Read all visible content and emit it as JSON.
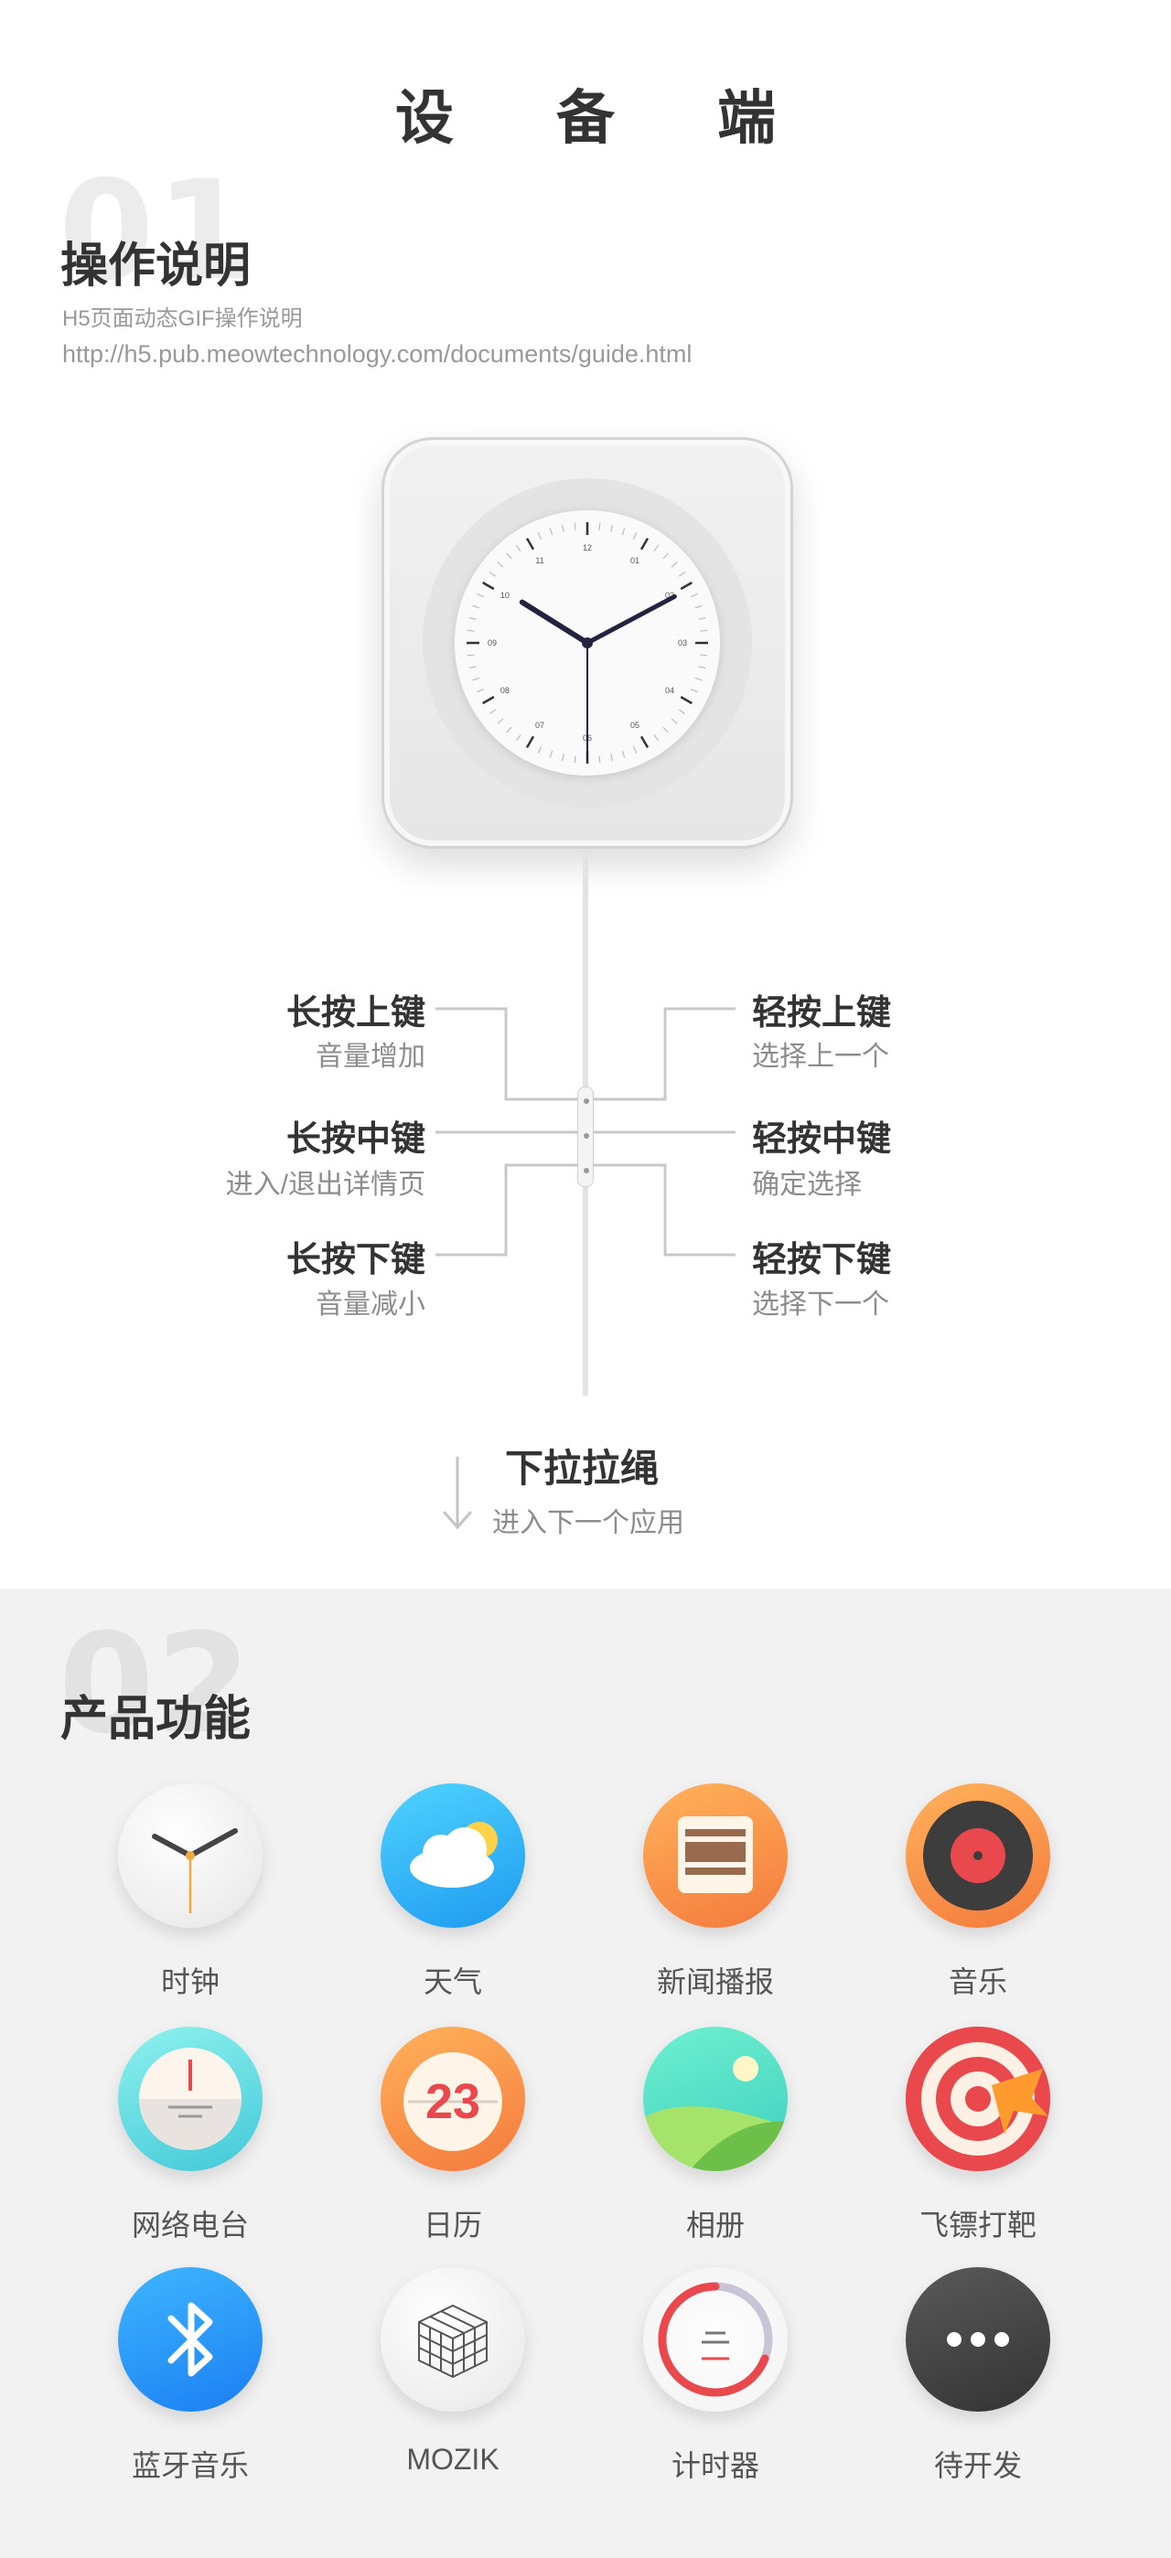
{
  "header": {
    "title": "设备端"
  },
  "section1": {
    "number": "01",
    "heading": "操作说明",
    "subtitle": "H5页面动态GIF操作说明",
    "url": "http://h5.pub.meowtechnology.com/documents/guide.html"
  },
  "clock": {
    "numbers": [
      "12",
      "01",
      "02",
      "03",
      "04",
      "05",
      "06",
      "07",
      "08",
      "09",
      "10",
      "11"
    ]
  },
  "controls": {
    "left": [
      {
        "title": "长按上键",
        "desc": "音量增加"
      },
      {
        "title": "长按中键",
        "desc": "进入/退出详情页"
      },
      {
        "title": "长按下键",
        "desc": "音量减小"
      }
    ],
    "right": [
      {
        "title": "轻按上键",
        "desc": "选择上一个"
      },
      {
        "title": "轻按中键",
        "desc": "确定选择"
      },
      {
        "title": "轻按下键",
        "desc": "选择下一个"
      }
    ],
    "pull": {
      "title": "下拉拉绳",
      "desc": "进入下一个应用"
    }
  },
  "section2": {
    "number": "02",
    "heading": "产品功能",
    "apps": [
      {
        "label": "时钟",
        "icon": "clock-icon"
      },
      {
        "label": "天气",
        "icon": "weather-icon"
      },
      {
        "label": "新闻播报",
        "icon": "news-icon"
      },
      {
        "label": "音乐",
        "icon": "music-icon"
      },
      {
        "label": "网络电台",
        "icon": "radio-icon"
      },
      {
        "label": "日历",
        "icon": "calendar-icon",
        "badge": "23"
      },
      {
        "label": "相册",
        "icon": "album-icon"
      },
      {
        "label": "飞镖打靶",
        "icon": "darts-icon"
      },
      {
        "label": "蓝牙音乐",
        "icon": "bluetooth-icon"
      },
      {
        "label": "MOZIK",
        "icon": "cube-icon"
      },
      {
        "label": "计时器",
        "icon": "timer-icon"
      },
      {
        "label": "待开发",
        "icon": "more-icon"
      }
    ]
  }
}
